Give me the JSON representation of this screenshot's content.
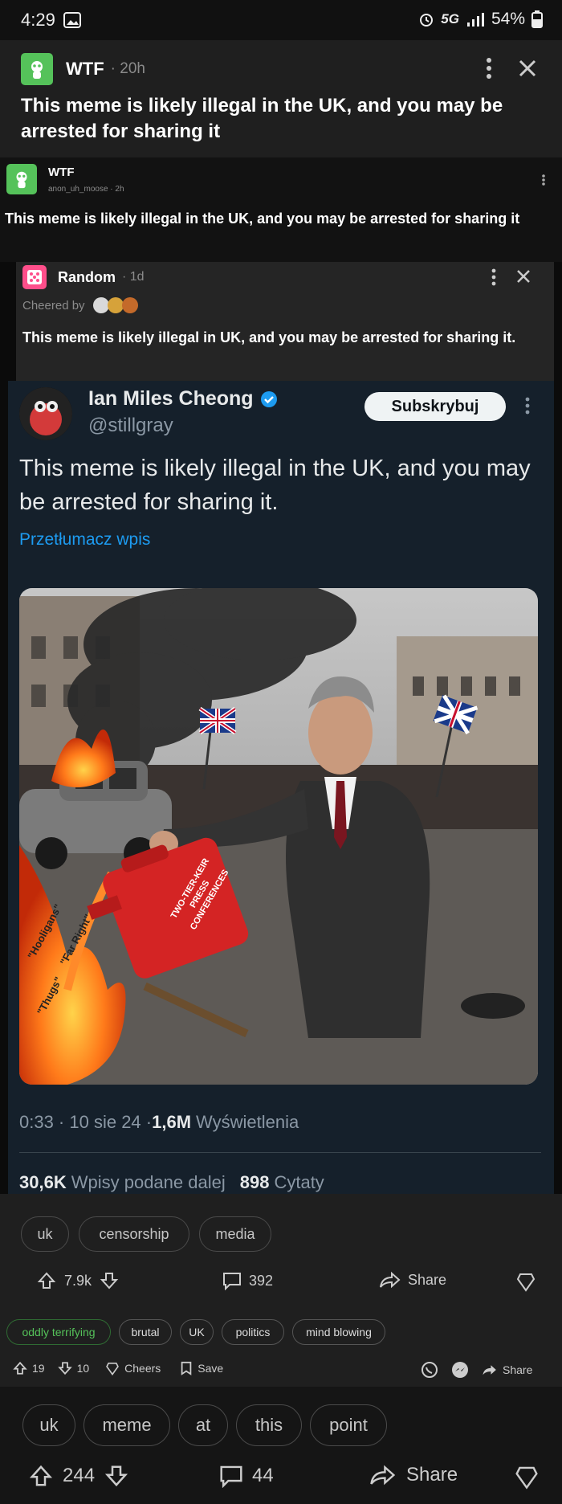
{
  "status": {
    "time": "4:29",
    "network": "5G",
    "battery": "54%"
  },
  "outer_post": {
    "community": "WTF",
    "age": "· 20h",
    "title": "This meme is likely illegal in the UK, and you may be arrested for sharing it"
  },
  "embedded_post": {
    "community": "WTF",
    "meta": "anon_uh_moose · 2h",
    "title": "This meme is likely illegal in the UK, and you may be arrested for sharing it"
  },
  "inner_post": {
    "community": "Random",
    "age": "· 1d",
    "cheered_by": "Cheered by",
    "title": "This meme is likely illegal in UK, and you may be arrested for sharing it."
  },
  "tweet": {
    "author": "Ian Miles Cheong",
    "handle": "@stillgray",
    "subscribe": "Subskrybuj",
    "text": "This meme is likely illegal in the UK, and you may be arrested for sharing it.",
    "translate": "Przetłumacz wpis",
    "meta_time": "0:33 · 10 sie 24 · ",
    "views_count": "1,6M",
    "views_label": "Wyświetlenia",
    "reposts_count": "30,6K",
    "reposts_label": "Wpisy podane dalej",
    "quotes_count": "898",
    "quotes_label": "Cytaty",
    "image_text": {
      "can": "TWO-TIER-KEIR PRESS CONFERENCES",
      "fire1": "\"Hooligans\"",
      "fire2": "\"Far Right\"",
      "fire3": "\"Thugs\""
    }
  },
  "inner_tags": [
    "uk",
    "censorship",
    "media"
  ],
  "inner_actions": {
    "votes": "7.9k",
    "comments": "392",
    "share": "Share"
  },
  "flairs": [
    "oddly terrifying",
    "brutal",
    "UK",
    "politics",
    "mind blowing"
  ],
  "embedded_actions": {
    "up": "19",
    "down": "10",
    "cheers": "Cheers",
    "save": "Save",
    "share": "Share"
  },
  "bottom_tags": [
    "uk",
    "meme",
    "at",
    "this",
    "point"
  ],
  "bottom_actions": {
    "votes": "244",
    "comments": "44",
    "share": "Share"
  },
  "colors": {
    "reddit_green": "#55c25a",
    "twitter_bg": "#15202b",
    "verified": "#1d9bf0",
    "link": "#1d9bf0"
  }
}
